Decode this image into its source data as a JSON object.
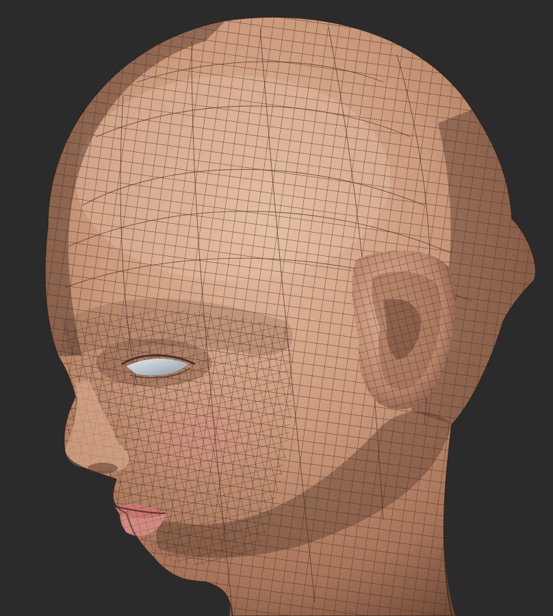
{
  "scene": {
    "subject": "sculpted-head-wireframe",
    "colors": {
      "background": "#2b2b2b",
      "skin_base": "#c9977a",
      "skin_light": "#e2b89a",
      "skin_shadow": "#8a5f48",
      "cheek_blush": "#d98e86",
      "lip": "#c8776f",
      "wire": "#3a2a22",
      "eye_white": "#d6dde3",
      "eye_shadow": "#8d98a3"
    }
  }
}
